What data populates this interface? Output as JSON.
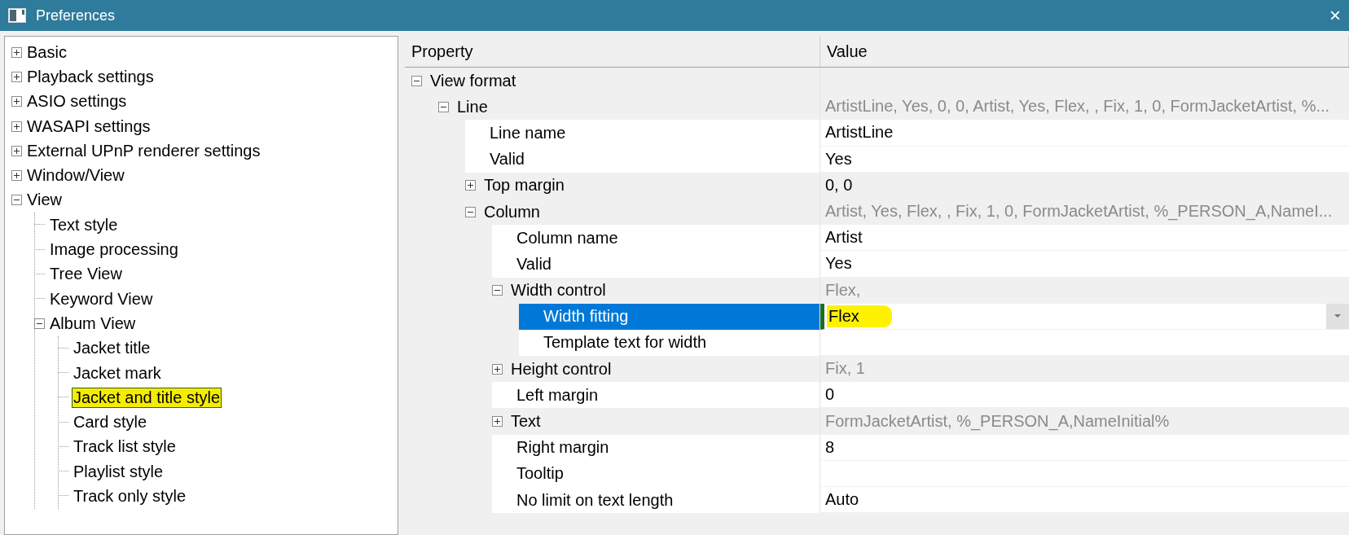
{
  "window": {
    "title": "Preferences",
    "close": "×"
  },
  "tree": [
    {
      "label": "Basic",
      "expanded": false,
      "selected": false
    },
    {
      "label": "Playback settings",
      "expanded": false,
      "selected": false
    },
    {
      "label": "ASIO settings",
      "expanded": false,
      "selected": false
    },
    {
      "label": "WASAPI settings",
      "expanded": false,
      "selected": false
    },
    {
      "label": "External UPnP renderer settings",
      "expanded": false,
      "selected": false
    },
    {
      "label": "Window/View",
      "expanded": false,
      "selected": false
    },
    {
      "label": "View",
      "expanded": true,
      "selected": false,
      "children": [
        {
          "label": "Text style",
          "selected": false
        },
        {
          "label": "Image processing",
          "selected": false
        },
        {
          "label": "Tree View",
          "selected": false
        },
        {
          "label": "Keyword View",
          "selected": false
        },
        {
          "label": "Album View",
          "expanded": true,
          "selected": false,
          "children": [
            {
              "label": "Jacket title",
              "selected": false
            },
            {
              "label": "Jacket mark",
              "selected": false
            },
            {
              "label": "Jacket and title style",
              "selected": true
            },
            {
              "label": "Card style",
              "selected": false
            },
            {
              "label": "Track list style",
              "selected": false
            },
            {
              "label": "Playlist style",
              "selected": false
            },
            {
              "label": "Track only style",
              "selected": false
            }
          ]
        }
      ]
    }
  ],
  "grid": {
    "columns": [
      "Property",
      "Value"
    ],
    "rows": [
      {
        "label": "View format",
        "expanded": true,
        "selected": false,
        "children": [
          {
            "label": "Line",
            "expanded": true,
            "selected": false,
            "value": "ArtistLine, Yes, 0, 0, Artist, Yes, Flex, , Fix, 1, 0, FormJacketArtist, %...",
            "dimmed": true,
            "children": [
              {
                "label": "Line name",
                "selected": false,
                "value": "ArtistLine",
                "dimmed": false
              },
              {
                "label": "Valid",
                "selected": false,
                "value": "Yes",
                "dimmed": false
              },
              {
                "label": "Top margin",
                "expanded": false,
                "selected": false,
                "value": "0, 0",
                "dimmed": false
              },
              {
                "label": "Column",
                "expanded": true,
                "selected": false,
                "value": "Artist, Yes, Flex, , Fix, 1, 0, FormJacketArtist, %_PERSON_A,NameI...",
                "dimmed": true,
                "children": [
                  {
                    "label": "Column name",
                    "selected": false,
                    "value": "Artist",
                    "dimmed": false
                  },
                  {
                    "label": "Valid",
                    "selected": false,
                    "value": "Yes",
                    "dimmed": false
                  },
                  {
                    "label": "Width control",
                    "expanded": true,
                    "selected": false,
                    "value": "Flex,",
                    "dimmed": true,
                    "children": [
                      {
                        "label": "Width fitting",
                        "selected": true,
                        "value": "Flex",
                        "dimmed": false,
                        "highlighted": true
                      },
                      {
                        "label": "Template text for width",
                        "selected": false
                      }
                    ]
                  },
                  {
                    "label": "Height control",
                    "expanded": false,
                    "selected": false,
                    "value": "Fix, 1",
                    "dimmed": true
                  },
                  {
                    "label": "Left margin",
                    "selected": false,
                    "value": "0",
                    "dimmed": false
                  },
                  {
                    "label": "Text",
                    "expanded": false,
                    "selected": false,
                    "value": "FormJacketArtist, %_PERSON_A,NameInitial%",
                    "dimmed": true
                  },
                  {
                    "label": "Right margin",
                    "selected": false,
                    "value": "8",
                    "dimmed": false
                  },
                  {
                    "label": "Tooltip",
                    "selected": false
                  },
                  {
                    "label": "No limit on text length",
                    "selected": false,
                    "value": "Auto",
                    "dimmed": false
                  }
                ]
              }
            ]
          }
        ]
      }
    ]
  }
}
